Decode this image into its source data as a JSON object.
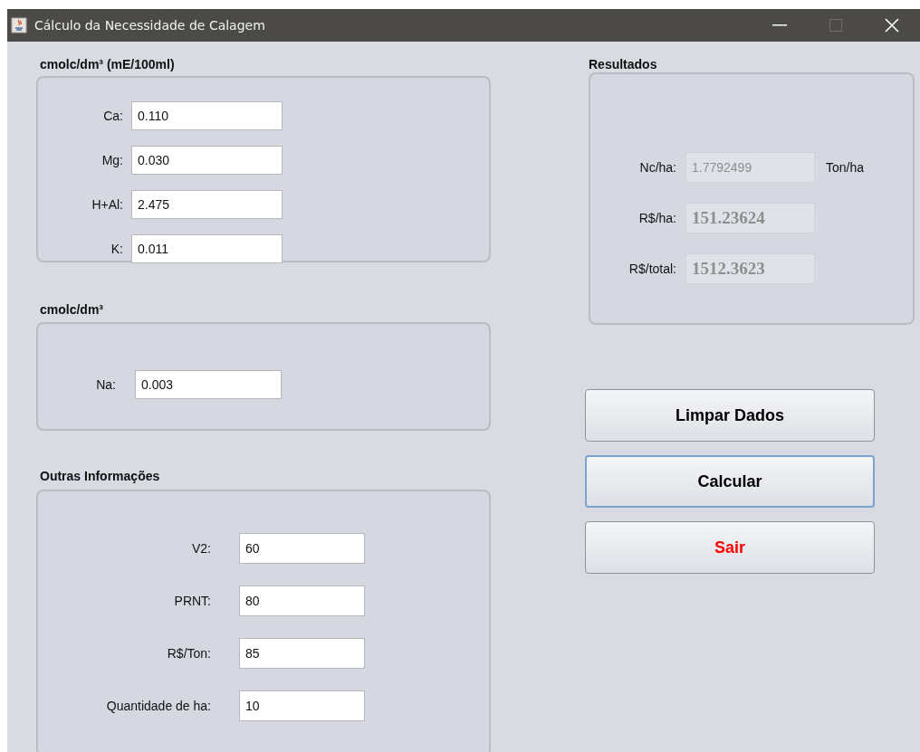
{
  "window": {
    "title": "Cálculo da Necessidade de Calagem",
    "maximize_enabled": false
  },
  "panels": [
    {
      "kind": "base",
      "title": "cmolc/dm³ (mE/100ml)",
      "fields": [
        {
          "label": "Ca:",
          "value": "0.110"
        },
        {
          "label": "Mg:",
          "value": "0.030"
        },
        {
          "label": "H+Al:",
          "value": "2.475"
        },
        {
          "label": "K:",
          "value": "0.011"
        }
      ]
    },
    {
      "kind": "sodium",
      "title": "cmolc/dm³",
      "fields": [
        {
          "label": "Na:",
          "value": "0.003"
        }
      ]
    },
    {
      "kind": "other",
      "title": "Outras Informações",
      "fields": [
        {
          "label": "V2:",
          "value": "60"
        },
        {
          "label": "PRNT:",
          "value": "80"
        },
        {
          "label": "R$/Ton:",
          "value": "85"
        },
        {
          "label": "Quantidade de ha:",
          "value": "10"
        }
      ]
    }
  ],
  "results": {
    "title": "Resultados",
    "fields": [
      {
        "label": "Nc/ha:",
        "value": "1.7792499",
        "unit": "Ton/ha",
        "kind": "sans",
        "disabled": true
      },
      {
        "label": "R$/ha:",
        "value": "151.23624",
        "kind": "serif",
        "disabled": true
      },
      {
        "label": "R$/total:",
        "value": "1512.3623",
        "kind": "serif",
        "disabled": true
      }
    ]
  },
  "buttons": [
    {
      "label": "Limpar Dados",
      "color": "#000000",
      "focused": false
    },
    {
      "label": "Calcular",
      "color": "#000000",
      "focused": true
    },
    {
      "label": "Sair",
      "color": "#ff0000",
      "focused": false
    }
  ]
}
